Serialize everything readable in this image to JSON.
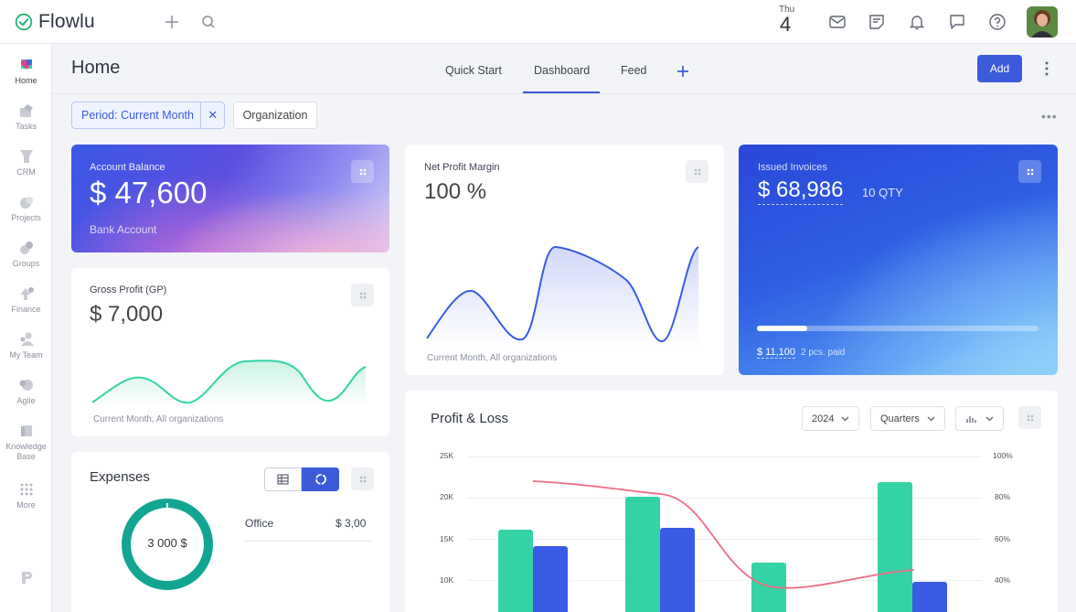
{
  "app": {
    "name": "Flowlu"
  },
  "topbar": {
    "day_name": "Thu",
    "day_number": "4"
  },
  "sidebar": {
    "items": [
      {
        "label": "Home"
      },
      {
        "label": "Tasks"
      },
      {
        "label": "CRM"
      },
      {
        "label": "Projects"
      },
      {
        "label": "Groups"
      },
      {
        "label": "Finance"
      },
      {
        "label": "My Team"
      },
      {
        "label": "Agile"
      },
      {
        "label": "Knowledge Base"
      },
      {
        "label": "More"
      }
    ]
  },
  "header": {
    "title": "Home",
    "tabs": [
      {
        "label": "Quick Start"
      },
      {
        "label": "Dashboard"
      },
      {
        "label": "Feed"
      }
    ],
    "add_label": "Add"
  },
  "filters": {
    "period": "Period: Current Month",
    "organization": "Organization"
  },
  "account_balance": {
    "label": "Account Balance",
    "value": "$ 47,600",
    "sub": "Bank Account"
  },
  "net_profit": {
    "label": "Net Profit Margin",
    "value": "100 %",
    "footer": "Current Month, All organizations"
  },
  "invoices": {
    "label": "Issued Invoices",
    "value": "$ 68,986",
    "qty": "10 QTY",
    "paid_amount": "$ 11,100",
    "paid_note": "2 pcs. paid",
    "progress": 0.18
  },
  "gross_profit": {
    "label": "Gross Profit (GP)",
    "value": "$ 7,000",
    "footer": "Current Month, All organizations"
  },
  "expenses": {
    "title": "Expenses",
    "donut_value": "3 000 $",
    "row_label": "Office",
    "row_value": "$ 3,00"
  },
  "profit_loss": {
    "title": "Profit & Loss",
    "year": "2024",
    "period": "Quarters",
    "y_left": [
      "25K",
      "20K",
      "15K",
      "10K"
    ],
    "y_right": [
      "100%",
      "80%",
      "60%",
      "40%"
    ]
  },
  "colors": {
    "accent": "#3b5bdb",
    "green": "#34d3a6",
    "blue": "#3a5be3",
    "red_line": "#f06b84",
    "teal": "#12a594"
  }
}
